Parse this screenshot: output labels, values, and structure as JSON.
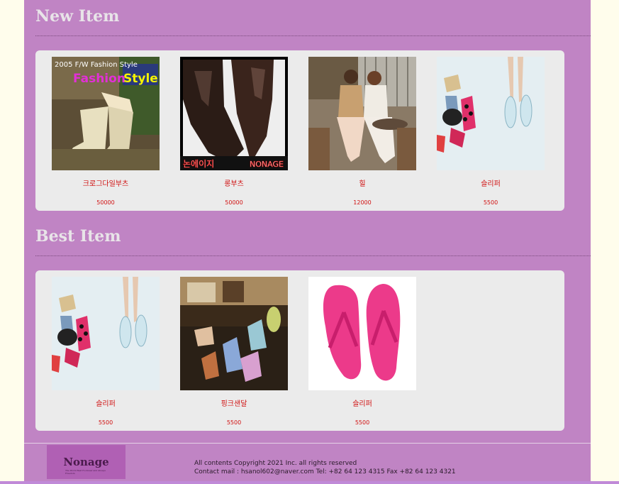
{
  "sections": {
    "new_item": {
      "title": "New Item",
      "items": [
        {
          "name": "크로그다일부츠",
          "price": "50000",
          "image_text": "2005 F/W Fashion Style"
        },
        {
          "name": "롱부츠",
          "price": "50000",
          "image_text_left": "논에이지",
          "image_text_right": "NONAGE"
        },
        {
          "name": "힐",
          "price": "12000"
        },
        {
          "name": "슬리퍼",
          "price": "5500"
        }
      ]
    },
    "best_item": {
      "title": "Best Item",
      "items": [
        {
          "name": "슬리퍼",
          "price": "5500"
        },
        {
          "name": "핑크샌달",
          "price": "5500"
        },
        {
          "name": "슬리퍼",
          "price": "5500"
        }
      ]
    }
  },
  "footer": {
    "logo_text": "Nonage",
    "logo_sub": "The World Best Footwear and Always Freedom",
    "copyright": "All contents Copyright 2021 Inc. all rights reserved",
    "contact": "Contact mail : hsanol602@naver.com Tel: +82 64 123 4315 Fax +82 64 123 4321"
  },
  "colors": {
    "page_bg": "#fffdec",
    "main_bg": "#c084c4",
    "panel_bg": "#ebebeb",
    "accent_text": "#d01010",
    "title_text": "#e8e4e8"
  }
}
